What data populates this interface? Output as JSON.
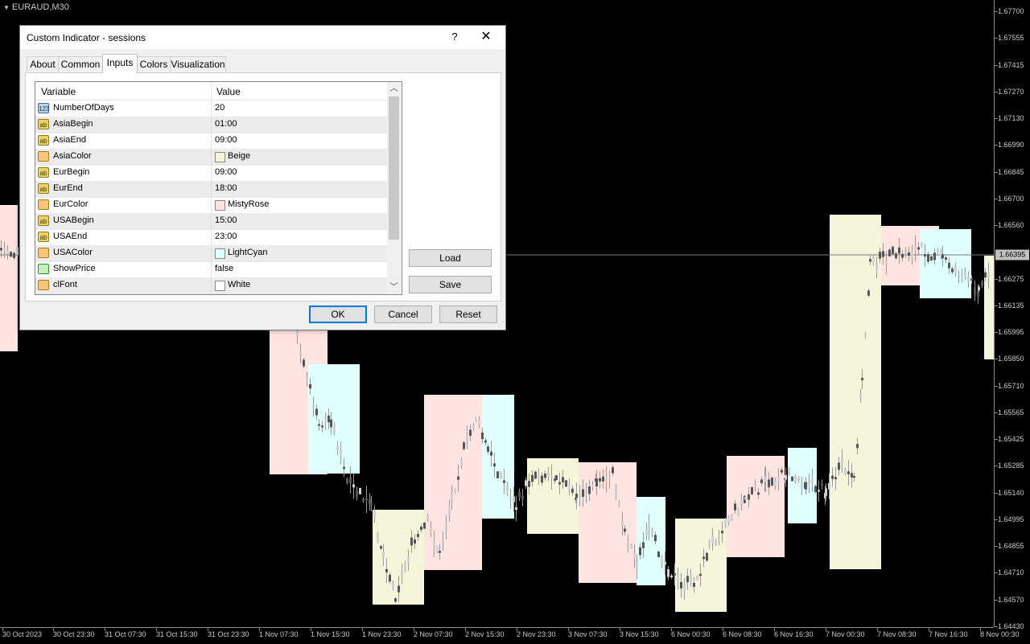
{
  "chart": {
    "symbol": "EURAUD,M30",
    "price_labels": [
      "1.67700",
      "1.67555",
      "1.67415",
      "1.67270",
      "1.67130",
      "1.66990",
      "1.66845",
      "1.66700",
      "1.66560",
      "1.66275",
      "1.66135",
      "1.65995",
      "1.65850",
      "1.65710",
      "1.65565",
      "1.65425",
      "1.65285",
      "1.65140",
      "1.64995",
      "1.64855",
      "1.64710",
      "1.64570",
      "1.64430"
    ],
    "current_price": "1.66395",
    "time_labels": [
      "30 Oct 2023",
      "30 Oct 23:30",
      "31 Oct 07:30",
      "31 Oct 15:30",
      "31 Oct 23:30",
      "1 Nov 07:30",
      "1 Nov 15:30",
      "1 Nov 23:30",
      "2 Nov 07:30",
      "2 Nov 15:30",
      "2 Nov 23:30",
      "3 Nov 07:30",
      "3 Nov 15:30",
      "6 Nov 00:30",
      "6 Nov 08:30",
      "6 Nov 16:30",
      "7 Nov 00:30",
      "7 Nov 08:30",
      "7 Nov 16:30",
      "8 Nov 00:30"
    ],
    "session_colors": {
      "asia": "#f5f5dc",
      "eur": "#ffe4e1",
      "usa": "#e0ffff"
    }
  },
  "dialog": {
    "title": "Custom Indicator - sessions",
    "help": "?",
    "close": "✕",
    "tabs": [
      "About",
      "Common",
      "Inputs",
      "Colors",
      "Visualization"
    ],
    "active_tab": "Inputs",
    "grid": {
      "col_variable": "Variable",
      "col_value": "Value",
      "rows": [
        {
          "type": "int",
          "icon": "123",
          "name": "NumberOfDays",
          "value": "20"
        },
        {
          "type": "str",
          "icon": "ab",
          "name": "AsiaBegin",
          "value": "01:00"
        },
        {
          "type": "str",
          "icon": "ab",
          "name": "AsiaEnd",
          "value": "09:00"
        },
        {
          "type": "col",
          "icon": "",
          "name": "AsiaColor",
          "value": "Beige",
          "swatch": "#f5f5dc"
        },
        {
          "type": "str",
          "icon": "ab",
          "name": "EurBegin",
          "value": "09:00"
        },
        {
          "type": "str",
          "icon": "ab",
          "name": "EurEnd",
          "value": "18:00"
        },
        {
          "type": "col",
          "icon": "",
          "name": "EurColor",
          "value": "MistyRose",
          "swatch": "#ffe4e1"
        },
        {
          "type": "str",
          "icon": "ab",
          "name": "USABegin",
          "value": "15:00"
        },
        {
          "type": "str",
          "icon": "ab",
          "name": "USAEnd",
          "value": "23:00"
        },
        {
          "type": "col",
          "icon": "",
          "name": "USAColor",
          "value": "LightCyan",
          "swatch": "#e0ffff"
        },
        {
          "type": "bool",
          "icon": "",
          "name": "ShowPrice",
          "value": "false"
        },
        {
          "type": "col",
          "icon": "",
          "name": "clFont",
          "value": "White",
          "swatch": "#ffffff"
        }
      ]
    },
    "buttons": {
      "load": "Load",
      "save": "Save",
      "ok": "OK",
      "cancel": "Cancel",
      "reset": "Reset"
    }
  }
}
